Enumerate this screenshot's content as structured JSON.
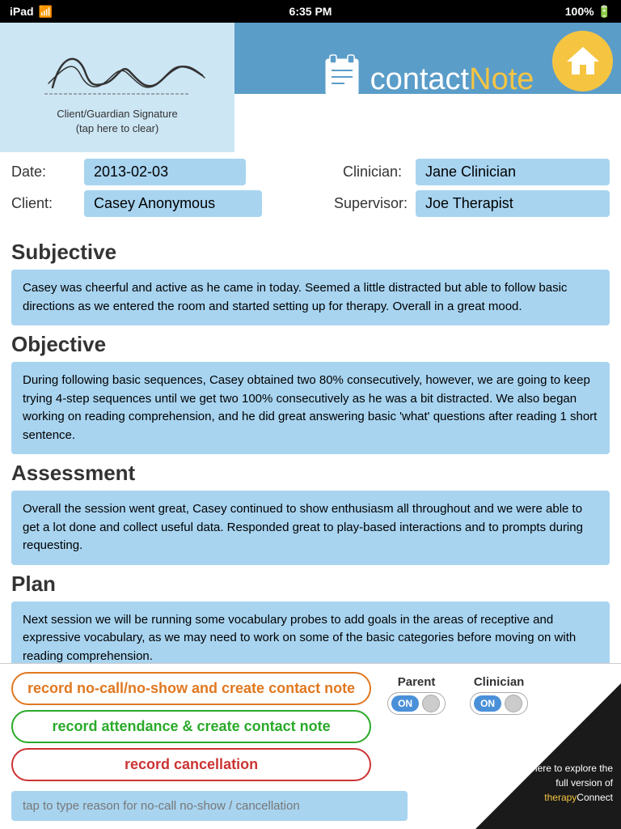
{
  "statusBar": {
    "left": "iPad",
    "time": "6:35 PM",
    "battery": "100%"
  },
  "header": {
    "signatureLabel": "Client/Guardian Signature",
    "signatureTapHint": "(tap here to clear)",
    "logoContact": "contact",
    "logoNote": "Note"
  },
  "form": {
    "dateLabel": "Date:",
    "dateValue": "2013-02-03",
    "clinicianLabel": "Clinician:",
    "clinicianValue": "Jane Clinician",
    "clientLabel": "Client:",
    "clientValue": "Casey Anonymous",
    "supervisorLabel": "Supervisor:",
    "supervisorValue": "Joe Therapist"
  },
  "soap": {
    "subjectiveHeader": "Subjective",
    "subjectiveText": "Casey was cheerful and active as he came in today. Seemed a little distracted but able to follow basic directions as we entered the room and started setting up for therapy. Overall in a great mood.",
    "objectiveHeader": "Objective",
    "objectiveText": "During following basic sequences, Casey obtained two 80% consecutively, however, we are going to keep trying 4-step sequences until we get two 100% consecutively as he was a bit distracted. We also began working on reading comprehension, and he did great answering basic 'what' questions after reading 1 short sentence.",
    "assessmentHeader": "Assessment",
    "assessmentText": "Overall the session went great, Casey continued to show enthusiasm all throughout and we were able to get a lot done and collect useful data. Responded great to play-based interactions and to prompts during requesting.",
    "planHeader": "Plan",
    "planText": "Next session we will be running some vocabulary probes to add goals in the areas of receptive and expressive vocabulary, as we may need to work on some of the basic categories before moving on with reading comprehension."
  },
  "actions": {
    "btn1": "record no-call/no-show and create contact note",
    "btn2": "record attendance & create contact note",
    "btn3": "record cancellation",
    "cancellationPlaceholder": "tap to type reason for no-call no-show / cancellation"
  },
  "toggles": {
    "parentLabel": "Parent",
    "parentOn": "ON",
    "clinicianLabel": "Clinician",
    "clinicianOn": "ON"
  },
  "watermark": {
    "line1": "tap here to explore the",
    "line2": "full version of",
    "line3": "therapy",
    "line4": "Connect"
  }
}
